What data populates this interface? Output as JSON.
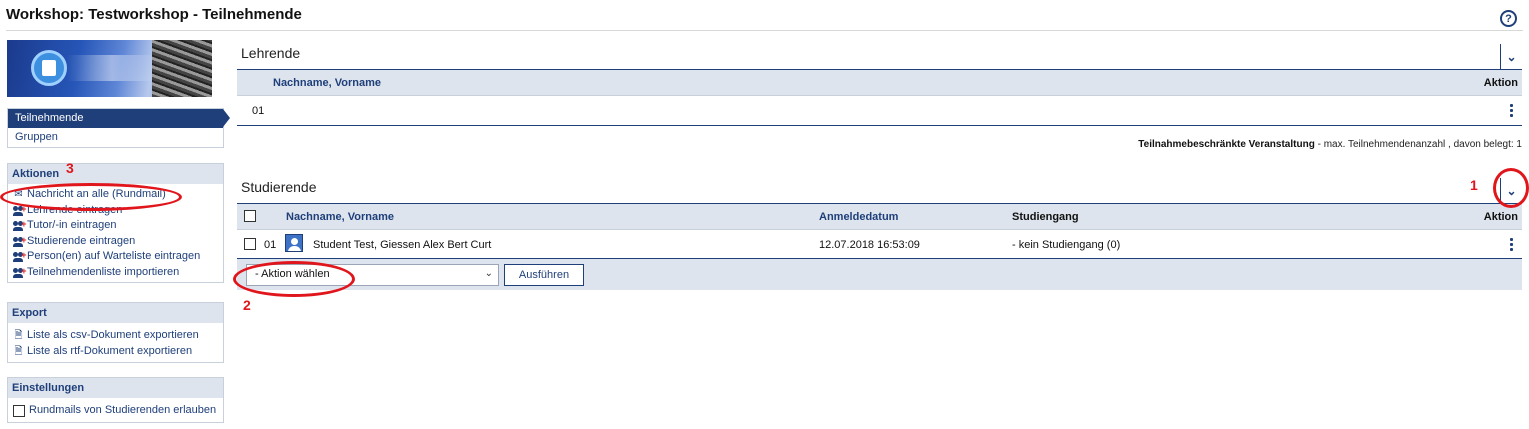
{
  "header": {
    "title": "Workshop: Testworkshop - Teilnehmende",
    "help_icon": "help-icon"
  },
  "sidebar": {
    "nav": [
      {
        "label": "Teilnehmende",
        "active": true
      },
      {
        "label": "Gruppen",
        "active": false
      }
    ],
    "aktionen": {
      "title": "Aktionen",
      "items": [
        {
          "label": "Nachricht an alle (Rundmail)",
          "icon": "mail-icon"
        },
        {
          "label": "Lehrende eintragen",
          "icon": "add-people-icon"
        },
        {
          "label": "Tutor/-in eintragen",
          "icon": "add-people-icon"
        },
        {
          "label": "Studierende eintragen",
          "icon": "add-people-icon"
        },
        {
          "label": "Person(en) auf Warteliste eintragen",
          "icon": "add-people-icon"
        },
        {
          "label": "Teilnehmendenliste importieren",
          "icon": "add-people-icon"
        }
      ]
    },
    "export": {
      "title": "Export",
      "items": [
        {
          "label": "Liste als csv-Dokument exportieren",
          "icon": "document-icon"
        },
        {
          "label": "Liste als rtf-Dokument exportieren",
          "icon": "document-icon"
        }
      ]
    },
    "einstellungen": {
      "title": "Einstellungen",
      "items": [
        {
          "label": "Rundmails von Studierenden erlauben",
          "icon": "checkbox-icon",
          "checked": false
        }
      ]
    }
  },
  "lehrende": {
    "title": "Lehrende",
    "columns": {
      "name": "Nachname, Vorname",
      "aktion": "Aktion"
    },
    "rows": [
      {
        "nr": "01",
        "name": ""
      }
    ]
  },
  "note": {
    "bold": "Teilnahmebeschränkte Veranstaltung",
    "rest": " - max. Teilnehmendenanzahl , davon belegt: 1"
  },
  "studierende": {
    "title": "Studierende",
    "columns": {
      "name": "Nachname, Vorname",
      "datum": "Anmeldedatum",
      "studiengang": "Studiengang",
      "aktion": "Aktion"
    },
    "rows": [
      {
        "nr": "01",
        "name": "Student Test, Giessen Alex Bert Curt",
        "datum": "12.07.2018 16:53:09",
        "studiengang": "- kein Studiengang (0)"
      }
    ],
    "action_select": "- Aktion wählen",
    "action_button": "Ausführen"
  },
  "annotations": {
    "one": "1",
    "two": "2",
    "three": "3",
    "color": "#e0161c"
  },
  "colors": {
    "accent": "#1f3f7a",
    "header_bg": "#dde4ed"
  }
}
